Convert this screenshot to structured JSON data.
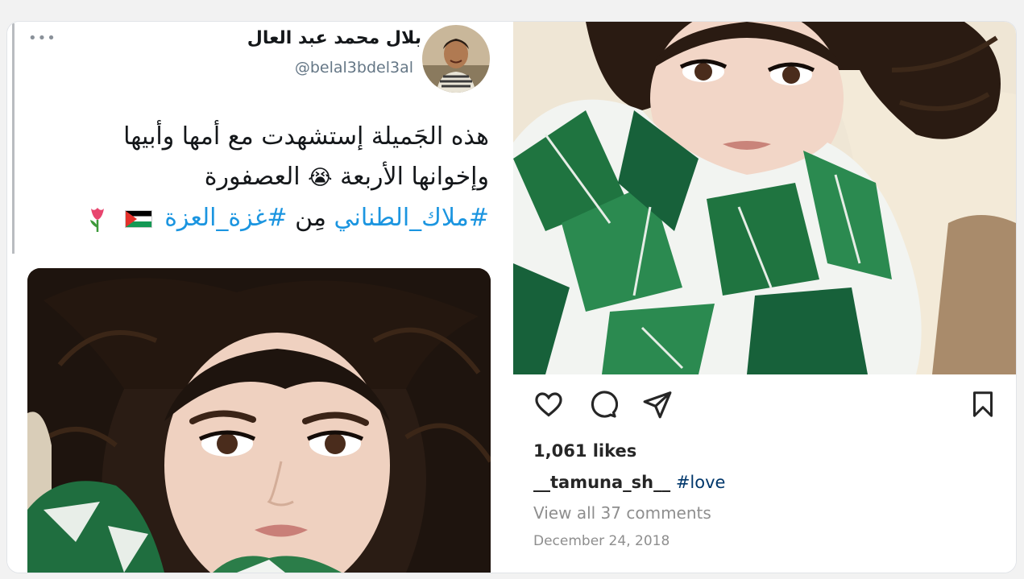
{
  "tweet": {
    "display_name": "بلال محمد عبد العال",
    "handle": "@belal3bdel3al",
    "text_line1": "هذه الجَميلة إستشهدت مع أمها وأبيها",
    "text_line2_a": "وإخوانها الأربعة",
    "text_line2_emoji": "😭",
    "text_line2_b": "العصفورة",
    "hashtag1": "#ملاك_الطناني",
    "connector": "مِن",
    "hashtag2": "#غزة_العزة",
    "more_icon": "more-dots-icon",
    "link_color": "#1b95e0"
  },
  "instagram": {
    "likes": "1,061 likes",
    "caption_user": "__tamuna_sh__",
    "caption_tag": "#love",
    "view_comments": "View all 37 comments",
    "date": "December 24, 2018",
    "icons": [
      "heart-icon",
      "comment-icon",
      "share-icon",
      "bookmark-icon"
    ]
  }
}
